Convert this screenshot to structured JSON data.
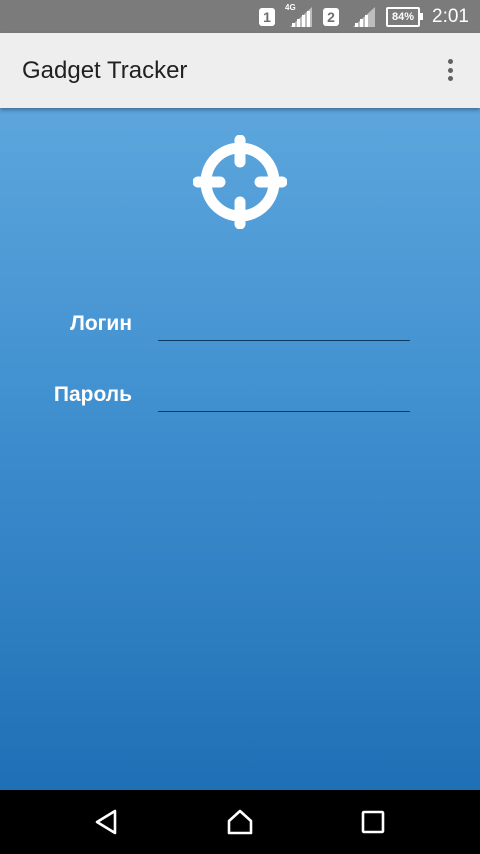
{
  "status_bar": {
    "sim1": "1",
    "sim2": "2",
    "network_type": "4G",
    "battery": "84%",
    "time": "2:01"
  },
  "app_bar": {
    "title": "Gadget Tracker",
    "menu_icon": "more-vert-icon"
  },
  "main": {
    "logo_icon": "crosshair-target-icon",
    "login_label": "Логин",
    "login_value": "",
    "password_label": "Пароль",
    "password_value": ""
  },
  "nav_bar": {
    "back_icon": "back-triangle-icon",
    "home_icon": "home-icon",
    "recents_icon": "recents-square-icon"
  },
  "colors": {
    "gradient_top": "#5da6dd",
    "gradient_bottom": "#1f6fb6",
    "app_bar_bg": "#eeeeee",
    "status_bar_bg": "#7b7b7b"
  }
}
